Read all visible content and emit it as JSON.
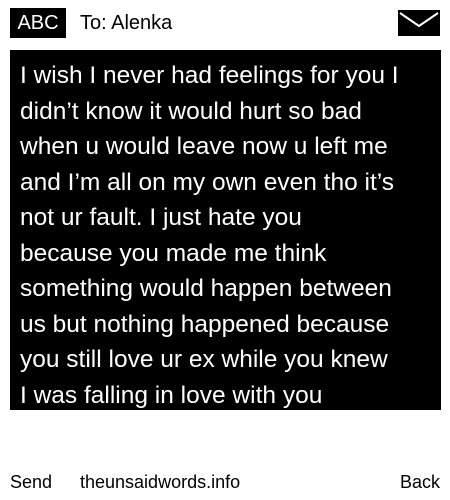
{
  "header": {
    "input_mode": "ABC",
    "recipient": "To: Alenka",
    "icon": "envelope-icon"
  },
  "message": {
    "text": "I wish I never had feelings for you I\ndidn’t know it would hurt so bad\nwhen u would leave now u left me\nand I’m all on my own even tho it’s\nnot ur fault. I just hate you\nbecause you made me think\nsomething would happen between\nus but nothing happened because\nyou still love ur ex while you knew\nI was falling in love with you"
  },
  "softkeys": {
    "left_label": "Send",
    "center_text": "theunsaidwords.info",
    "right_label": "Back"
  },
  "colors": {
    "background": "#ffffff",
    "message_background": "#000000",
    "message_text": "#ffffff"
  }
}
